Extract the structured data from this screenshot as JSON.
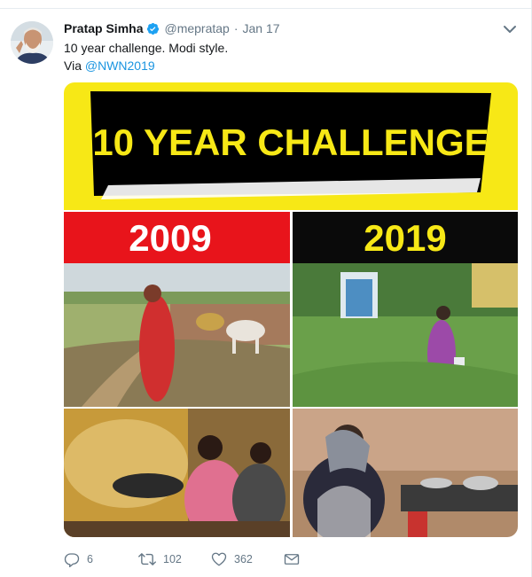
{
  "tweet": {
    "author_name": "Pratap Simha",
    "handle": "@mepratap",
    "separator": "·",
    "date": "Jan 17",
    "text_line1": "10 year challenge. Modi style.",
    "via_label": "Via ",
    "via_link": "@NWN2019"
  },
  "media": {
    "banner_title": "10 YEAR CHALLENGE",
    "year_left": "2009",
    "year_right": "2019",
    "colors": {
      "banner_yellow": "#f7e816",
      "banner_black": "#000000",
      "left_red": "#e8141b",
      "right_black": "#0a0a0a",
      "year_text_left": "#ffffff",
      "year_text_right": "#f7e816"
    }
  },
  "actions": {
    "reply_count": "6",
    "retweet_count": "102",
    "like_count": "362"
  },
  "colors": {
    "secondary_text": "#657786",
    "link": "#1b95e0",
    "verified": "#1da1f2"
  },
  "icons": {
    "reply": "reply-icon",
    "retweet": "retweet-icon",
    "like": "heart-icon",
    "message": "envelope-icon",
    "caret": "chevron-down-icon",
    "verified": "verified-badge-icon"
  }
}
